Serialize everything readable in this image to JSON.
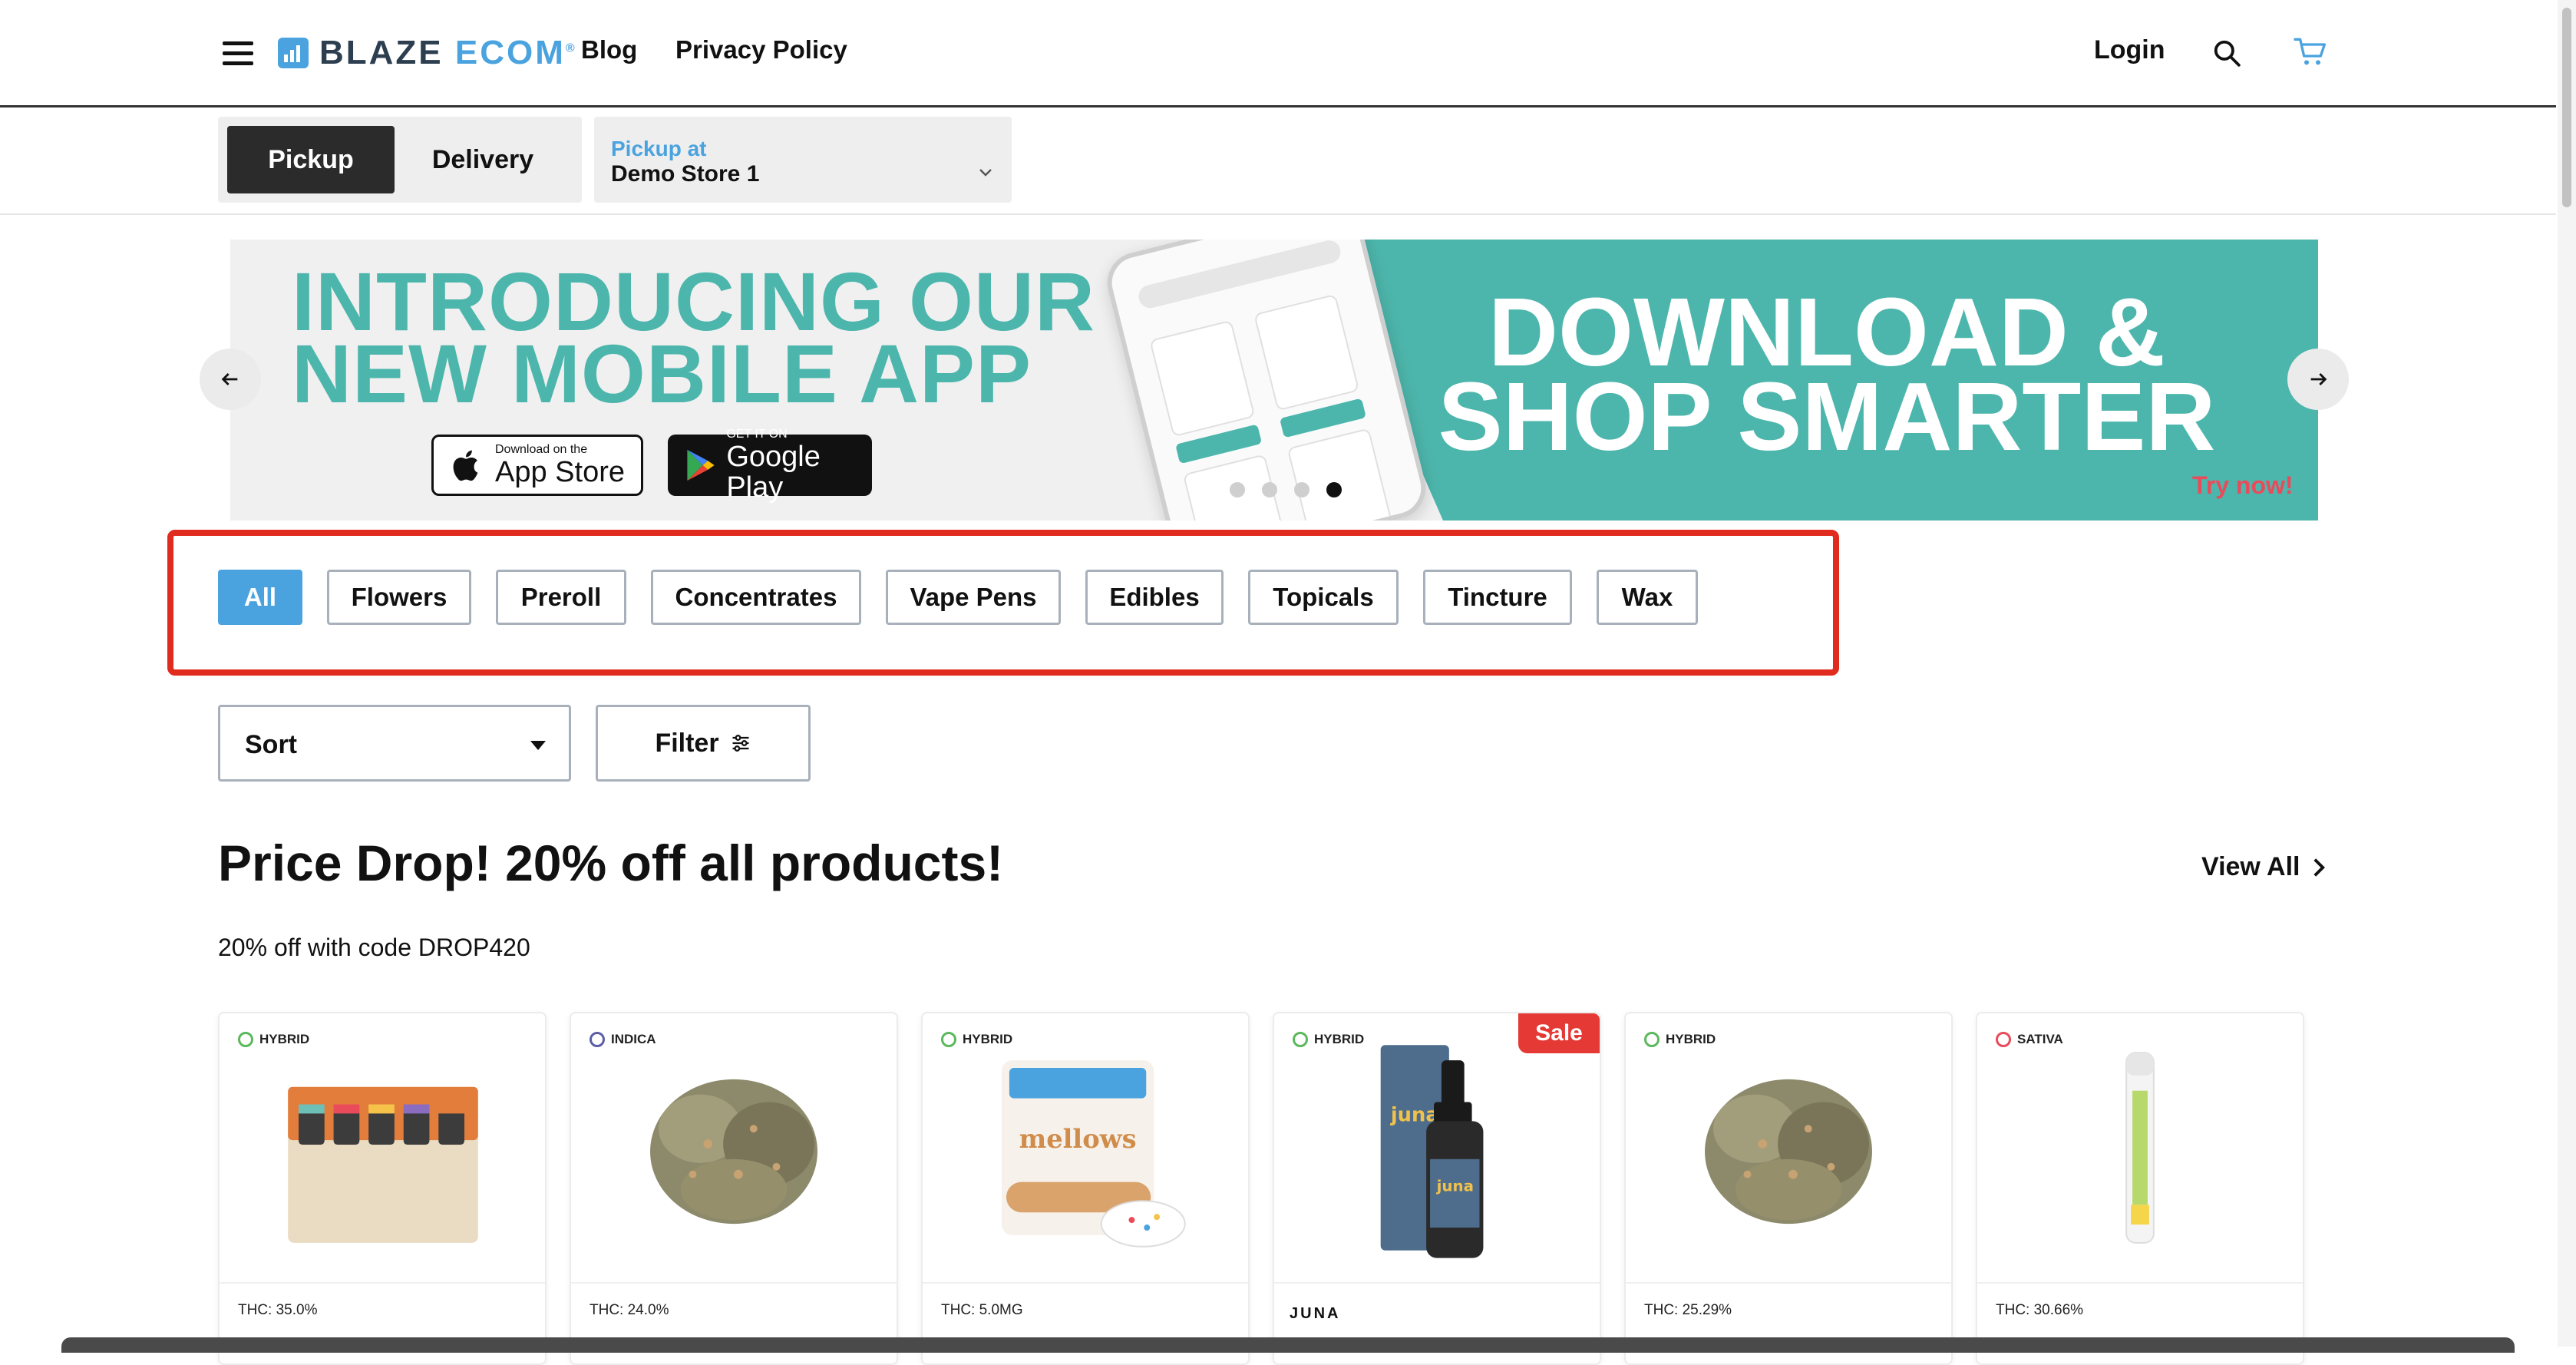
{
  "header": {
    "logo_text_main": "BLAZE",
    "logo_text_accent": "ECOM",
    "logo_tm": "®",
    "nav": [
      "Blog",
      "Privacy Policy"
    ],
    "login_label": "Login"
  },
  "order_mode": {
    "options": [
      "Pickup",
      "Delivery"
    ],
    "selected": "Pickup",
    "store_label": "Pickup at",
    "store_value": "Demo Store 1"
  },
  "banner": {
    "headline_line1": "INTRODUCING OUR",
    "headline_line2": "NEW MOBILE APP",
    "cta_line1": "DOWNLOAD &",
    "cta_line2": "SHOP SMARTER",
    "try_now": "Try now!",
    "app_store_small": "Download on the",
    "app_store_big": "App Store",
    "google_small": "GET IT ON",
    "google_big": "Google Play",
    "slide_count": 4,
    "active_slide": 4
  },
  "categories": {
    "items": [
      "All",
      "Flowers",
      "Preroll",
      "Concentrates",
      "Vape Pens",
      "Edibles",
      "Topicals",
      "Tincture",
      "Wax"
    ],
    "selected": "All"
  },
  "controls": {
    "sort_label": "Sort",
    "filter_label": "Filter"
  },
  "section": {
    "title": "Price Drop! 20% off all products!",
    "subtitle": "20% off with code DROP420",
    "view_all": "View All"
  },
  "products": [
    {
      "strain": "HYBRID",
      "thc": "THC: 35.0%",
      "image": "gift-box-jars"
    },
    {
      "strain": "INDICA",
      "thc": "THC: 24.0%",
      "image": "flower-bud"
    },
    {
      "strain": "HYBRID",
      "thc": "THC: 5.0MG",
      "image": "mellows-pouch"
    },
    {
      "strain": "HYBRID",
      "brand": "JUNA",
      "badge": "Sale",
      "image": "tincture-bottle"
    },
    {
      "strain": "HYBRID",
      "thc": "THC: 25.29%",
      "image": "flower-bud"
    },
    {
      "strain": "SATIVA",
      "thc": "THC: 30.66%",
      "image": "preroll-tube"
    }
  ],
  "colors": {
    "accent": "#4aa3df",
    "banner_teal": "#4db6ac",
    "highlight": "#e02b1f",
    "sale": "#e53935",
    "hybrid": "#5cb85c",
    "indica": "#5b5ea6",
    "sativa": "#e94b5b"
  }
}
